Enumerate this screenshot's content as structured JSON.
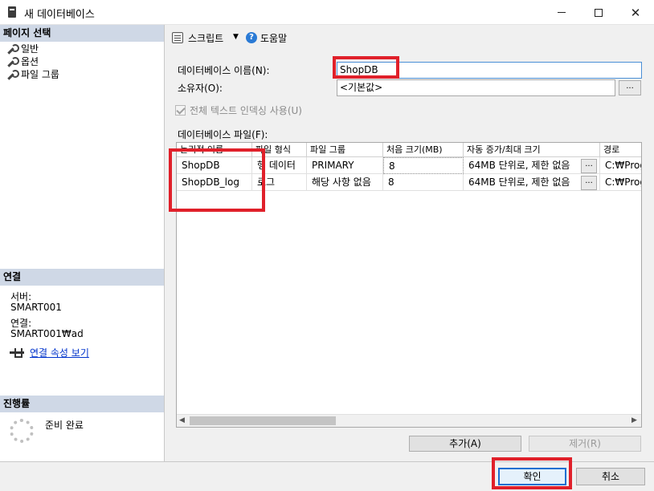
{
  "window": {
    "title": "새 데이터베이스",
    "controls": {
      "minimize": "minimize-icon",
      "maximize": "maximize-icon",
      "close": "✕"
    }
  },
  "sidebar": {
    "page_select_header": "페이지 선택",
    "items": [
      {
        "label": "일반",
        "icon": "wrench-icon"
      },
      {
        "label": "옵션",
        "icon": "wrench-icon"
      },
      {
        "label": "파일 그룹",
        "icon": "wrench-icon"
      }
    ],
    "connection_header": "연결",
    "server_label": "서버:",
    "server_value": "SMART001",
    "connection_label": "연결:",
    "connection_value": "SMART001₩ad",
    "connection_link": "연결 속성 보기",
    "progress_header": "진행률",
    "progress_status": "준비 완료"
  },
  "toolbar": {
    "script_label": "스크립트",
    "help_label": "도움말"
  },
  "form": {
    "db_name_label": "데이터베이스 이름(N):",
    "db_name_value": "ShopDB",
    "owner_label": "소유자(O):",
    "owner_value": "<기본값>",
    "browse_label": "...",
    "fulltext_label": "전체 텍스트 인덱싱 사용(U)",
    "fulltext_checked": true,
    "files_label": "데이터베이스 파일(F):"
  },
  "grid": {
    "columns": [
      "논리적 이름",
      "파일 형식",
      "파일 그룹",
      "처음 크기(MB)",
      "자동 증가/최대 크기",
      "경로"
    ],
    "rows": [
      {
        "logical": "ShopDB",
        "type": "행 데이터",
        "group": "PRIMARY",
        "size": "8",
        "growth": "64MB 단위로, 제한 없음",
        "path": "C:₩Prog"
      },
      {
        "logical": "ShopDB_log",
        "type": "로그",
        "group": "해당 사항 없음",
        "size": "8",
        "growth": "64MB 단위로, 제한 없음",
        "path": "C:₩Prog"
      }
    ],
    "row_button": "..."
  },
  "buttons": {
    "add": "추가(A)",
    "remove": "제거(R)",
    "ok": "확인",
    "cancel": "취소"
  },
  "colors": {
    "annotation_red": "#e0202a",
    "section_header_bg": "#cfd8e6",
    "link_blue": "#0033cc",
    "focus_blue": "#1a6fd1"
  }
}
